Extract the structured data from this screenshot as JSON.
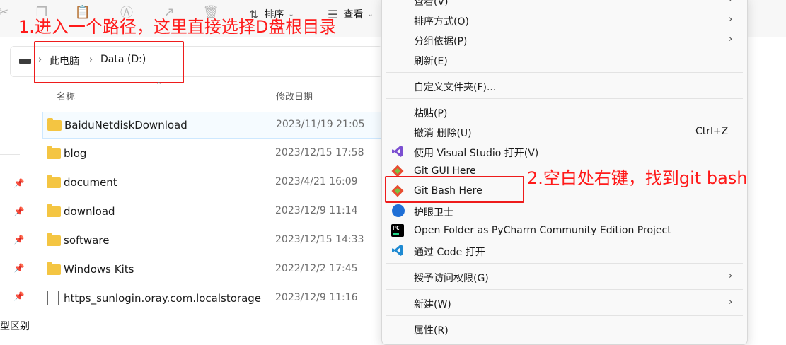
{
  "toolbar": {
    "sort_label": "排序",
    "view_label": "查看"
  },
  "breadcrumb": {
    "root": "此电脑",
    "drive": "Data (D:)"
  },
  "annotations": {
    "step1": "1.进入一个路径，这里直接选择D盘根目录",
    "step2": "2.空白处右键，找到git bash"
  },
  "columns": {
    "name": "名称",
    "modified": "修改日期"
  },
  "sidebar_partial_text": "型区别",
  "files": [
    {
      "name": "BaiduNetdiskDownload",
      "date": "2023/11/19 21:05",
      "type": "folder"
    },
    {
      "name": "blog",
      "date": "2023/12/15 17:58",
      "type": "folder"
    },
    {
      "name": "document",
      "date": "2023/4/21 16:09",
      "type": "folder"
    },
    {
      "name": "download",
      "date": "2023/12/9 11:14",
      "type": "folder"
    },
    {
      "name": "software",
      "date": "2023/12/15 14:33",
      "type": "folder"
    },
    {
      "name": "Windows Kits",
      "date": "2022/12/2 17:45",
      "type": "folder"
    },
    {
      "name": "https_sunlogin.oray.com.localstorage",
      "date": "2023/12/9 11:16",
      "type": "file"
    }
  ],
  "menu": {
    "view": "查看(V)",
    "sort_by": "排序方式(O)",
    "group_by": "分组依据(P)",
    "refresh": "刷新(E)",
    "customize": "自定义文件夹(F)...",
    "paste": "粘贴(P)",
    "undo_delete": "撤消 删除(U)",
    "undo_shortcut": "Ctrl+Z",
    "open_vs": "使用 Visual Studio 打开(V)",
    "git_gui": "Git GUI Here",
    "git_bash": "Git Bash Here",
    "eye_guard": "护眼卫士",
    "pycharm": "Open Folder as PyCharm Community Edition Project",
    "vscode": "通过 Code 打开",
    "grant_access": "授予访问权限(G)",
    "new": "新建(W)",
    "properties": "属性(R)"
  },
  "colors": {
    "annotation_red": "#ee1c1c",
    "folder_yellow": "#f4c542",
    "selection_border": "#cde8ff"
  }
}
